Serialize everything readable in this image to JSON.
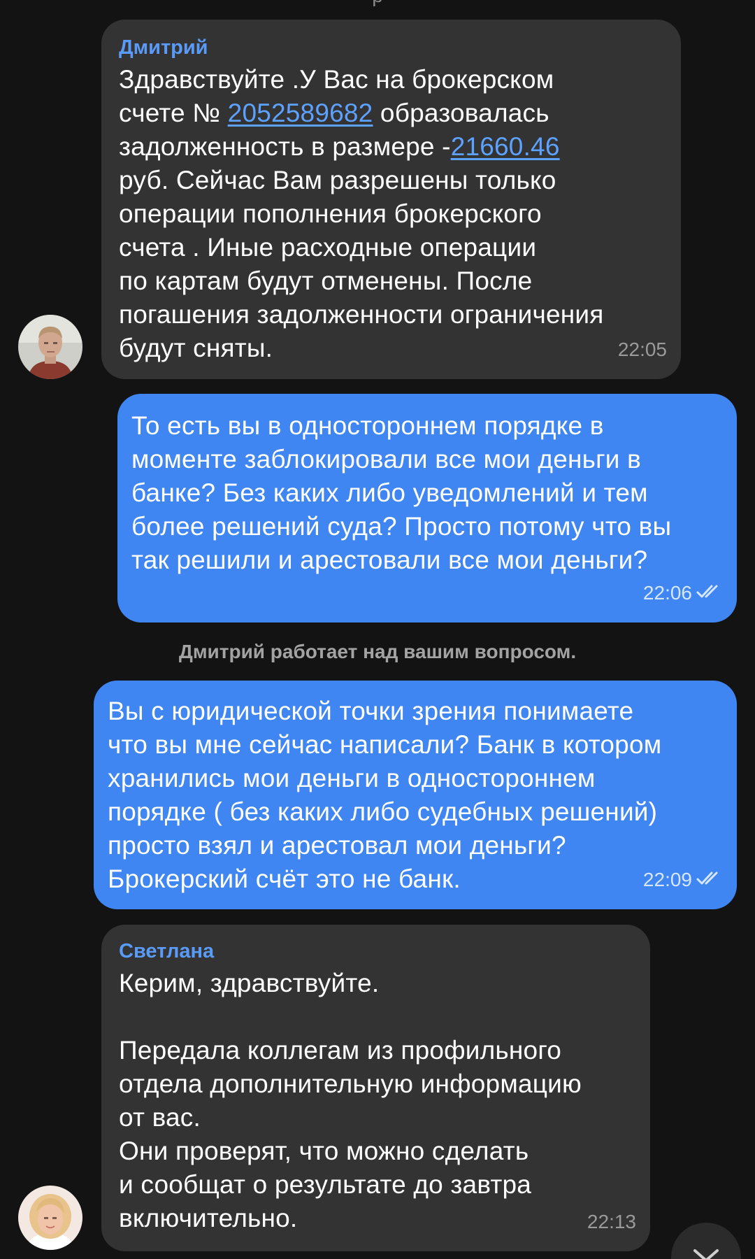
{
  "header": {
    "partial_text": "р"
  },
  "messages": [
    {
      "direction": "in",
      "sender": "Дмитрий",
      "text_before": "Здравствуйте .У Вас на брокерском\nсчете № ",
      "account_number": "2052589682",
      "text_mid": " образовалась\nзадолженность в размере -",
      "debt_amount": "21660.46",
      "text_after": "\nруб. Сейчас Вам разрешены только\nоперации пополнения брокерского\nсчета . Иные расходные операции\nпо картам будут отменены. После\nпогашения задолженности ограничения\nбудут сняты.",
      "time": "22:05",
      "avatar": "male-operator-avatar"
    },
    {
      "direction": "out",
      "text": "То есть вы в одностороннем порядке в\nмоменте заблокировали все мои деньги в\nбанке? Без каких либо уведомлений и тем\nболее решений суда? Просто потому что вы\nтак решили и арестовали все мои деньги?",
      "time": "22:06",
      "status": "read"
    },
    {
      "direction": "system",
      "text": "Дмитрий работает над вашим вопросом."
    },
    {
      "direction": "out",
      "text": "Вы с юридической точки зрения понимаете\nчто вы мне сейчас написали? Банк в котором\nхранились мои деньги в одностороннем\nпорядке ( без каких либо судебных решений)\nпросто взял и арестовал мои деньги?\nБрокерский счёт это не банк.",
      "time": "22:09",
      "status": "read"
    },
    {
      "direction": "in",
      "sender": "Светлана",
      "text": "Керим, здравствуйте.\n\nПередала коллегам из профильного\nотдела дополнительную информацию\nот вас.\nОни проверят, что можно сделать\nи сообщат о результате до завтра\nвключительно.",
      "time": "22:13",
      "avatar": "female-operator-avatar"
    }
  ],
  "icons": {
    "read_receipt": "double-check-icon",
    "scroll": "chevron-down-icon"
  },
  "colors": {
    "background": "#131313",
    "incoming_bubble": "#333333",
    "outgoing_bubble": "#3f86f3",
    "sender_name": "#5a9bf7",
    "link": "#5ea2ff"
  }
}
